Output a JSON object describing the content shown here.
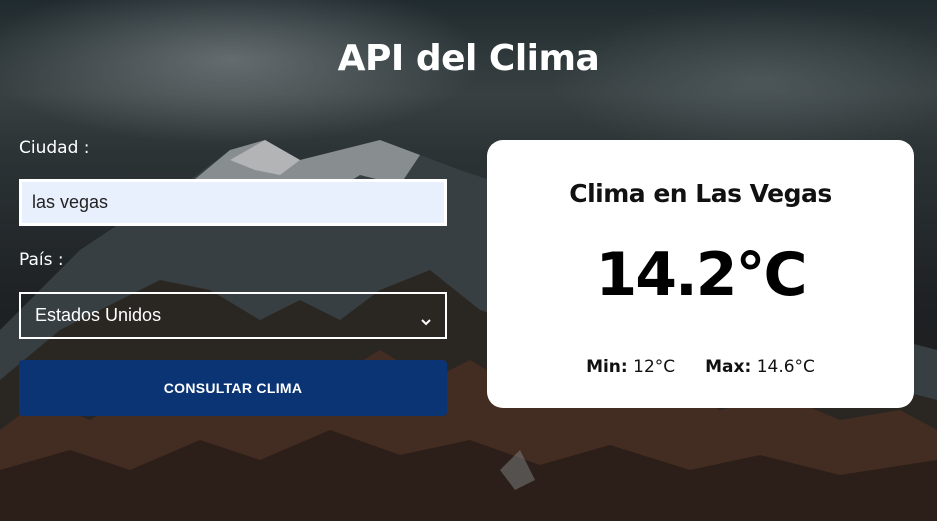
{
  "page": {
    "title": "API del Clima"
  },
  "form": {
    "city_label": "Ciudad :",
    "city_value": "las vegas",
    "country_label": "País :",
    "country_selected": "Estados Unidos",
    "submit_label": "CONSULTAR CLIMA"
  },
  "result": {
    "title": "Clima en Las Vegas",
    "temperature": "14.2°C",
    "min_label": "Min:",
    "min_value": "12°C",
    "max_label": "Max:",
    "max_value": "14.6°C"
  },
  "colors": {
    "button_bg": "#0a3474",
    "input_bg": "#e8f0fe",
    "card_bg": "#ffffff"
  },
  "icons": {
    "select_chevron": "chevron-down-icon"
  }
}
